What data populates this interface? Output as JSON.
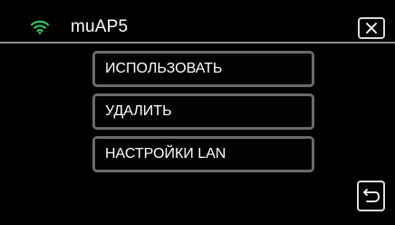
{
  "header": {
    "network_name": "muAP5",
    "wifi_icon": "wifi-icon",
    "close_icon": "close-icon",
    "accent_color": "#35c759"
  },
  "menu": {
    "items": [
      {
        "label": "ИСПОЛЬЗОВАТЬ"
      },
      {
        "label": "УДАЛИТЬ"
      },
      {
        "label": "НАСТРОЙКИ LAN"
      }
    ]
  },
  "footer": {
    "back_icon": "return-icon"
  }
}
